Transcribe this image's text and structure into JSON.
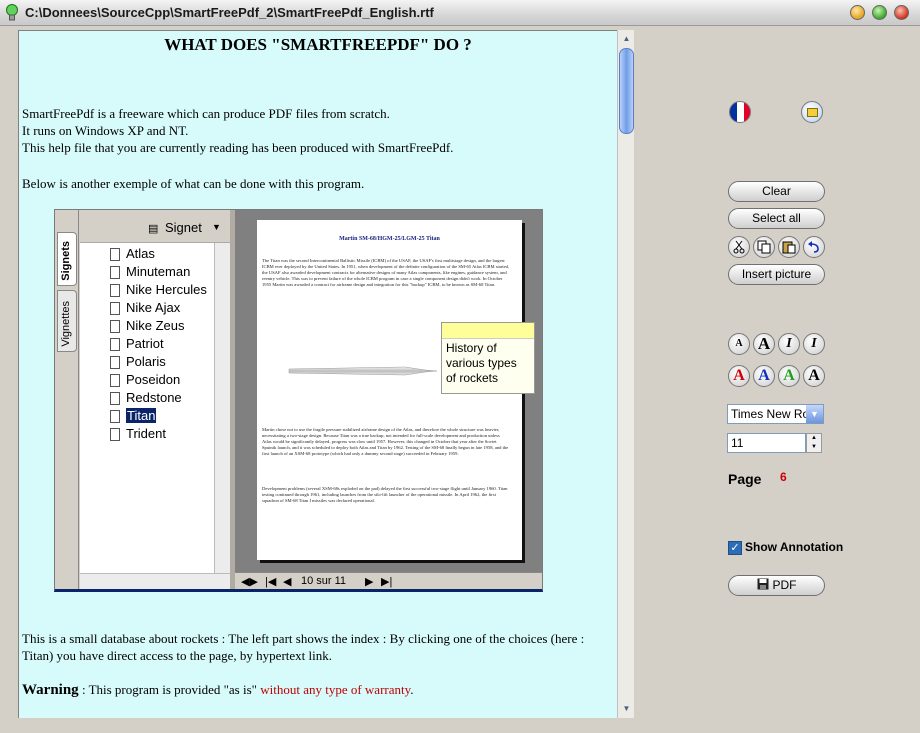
{
  "window": {
    "title": "C:\\Donnees\\SourceCpp\\SmartFreePdf_2\\SmartFreePdf_English.rtf"
  },
  "document": {
    "heading": "WHAT DOES  \"SMARTFREEPDF\"  DO ?",
    "intro_lines": [
      "SmartFreePdf is a freeware which can produce PDF files from scratch.",
      "It runs on Windows XP and NT.",
      "This help file that you are currently reading has been produced with SmartFreePdf."
    ],
    "below_text": "Below is another exemple of what can be done with this program.",
    "db_text": "This is a small database about rockets : The left part shows the index : By clicking one of the choices (here : Titan) you have direct access to the page, by hypertext link.",
    "warning_word": "Warning",
    "warning_text": " : This program is provided \"as is\" ",
    "warning_red": "without any type of warranty",
    "warning_end": "."
  },
  "embedded": {
    "tab_signets": "Signets",
    "tab_vignettes": "Vignettes",
    "signet_label": "Signet",
    "index_items": [
      "Atlas",
      "Minuteman",
      "Nike Hercules",
      "Nike Ajax",
      "Nike Zeus",
      "Patriot",
      "Polaris",
      "Poseidon",
      "Redstone",
      "Titan",
      "Trident"
    ],
    "selected_item": "Titan",
    "page_title": "Martin SM-68/HGM-25/LGM-25 Titan",
    "page_text_1": "The Titan was the second Intercontinental Ballistic Missile (ICBM) of the USAF, the USAF's first multistage design, and the largest ICBM ever deployed by the United States. In 1951, when development of the definite configuration of the SM-65 Atlas ICBM started, the USAF also awarded development contracts for alternative designs of many Atlas components, like engines, guidance system, and reentry vehicle. This was to prevent failure of the whole ICBM program in case a single component design didn't work. In October 1955 Martin was awarded a contract for airframe design and integration for this \"backup\" ICBM, to be known as SM-68 Titan.",
    "page_text_2": "Martin chose not to use the fragile pressure stabilized airframe design of the Atlas, and therefore the whole structure was heavier, necessitating a two-stage design. Because Titan was a true backup, not intended for full-scale development and production unless Atlas would be significantly delayed, progress was slow until 1957. However, this changed in October that year after the Soviet Sputnik launch, and it was scheduled to deploy both Atlas and Titan by 1962. Testing of the SM-68 finally begun in late 1958, and the first launch of an XSM-68 prototype (which had only a dummy second stage) succeeded in February 1959.",
    "page_text_3": "Development problems (several XSM-68s exploded on the pad) delayed the first successful two-stage flight until January 1960. Titan testing continued through 1961, including launches from the silo-lift launcher of the operational missile. In April 1962, the first squadron of SM-68 Titan I missiles was declared operational.",
    "note_text": "History of various types of rockets",
    "nav_page": "10 sur 11"
  },
  "toolbar": {
    "clear": "Clear",
    "select_all": "Select all",
    "insert_picture": "Insert picture",
    "font_name": "Times New Ro",
    "font_size": "11",
    "page_label": "Page",
    "page_number": "6",
    "show_annotation": "Show Annotation",
    "pdf": "PDF",
    "icons": [
      "french-flag-icon",
      "open-folder-icon",
      "cut-icon",
      "copy-icon",
      "paste-icon",
      "undo-icon"
    ],
    "font_buttons": [
      "A",
      "A",
      "I",
      "I"
    ],
    "color_buttons": [
      {
        "label": "A",
        "color": "#d00000"
      },
      {
        "label": "A",
        "color": "#1030c0"
      },
      {
        "label": "A",
        "color": "#20a020"
      },
      {
        "label": "A",
        "color": "#000000"
      }
    ]
  }
}
